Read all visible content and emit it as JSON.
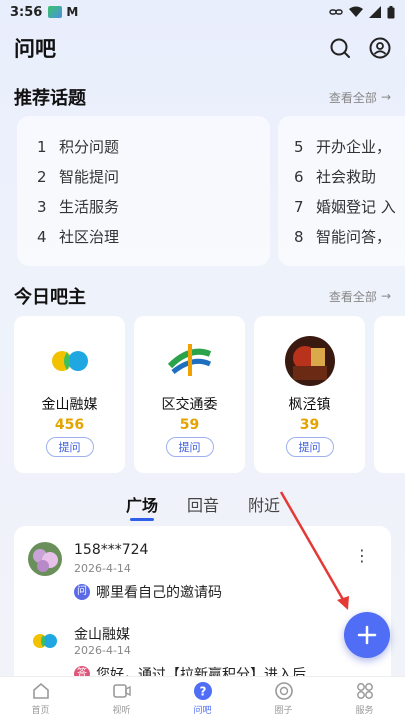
{
  "status": {
    "time": "3:56"
  },
  "header": {
    "title": "问吧"
  },
  "recommended": {
    "title": "推荐话题",
    "more": "查看全部",
    "topics": [
      {
        "num": "1",
        "label": "积分问题"
      },
      {
        "num": "2",
        "label": "智能提问"
      },
      {
        "num": "3",
        "label": "生活服务"
      },
      {
        "num": "4",
        "label": "社区治理"
      },
      {
        "num": "5",
        "label": "开办企业，"
      },
      {
        "num": "6",
        "label": "社会救助"
      },
      {
        "num": "7",
        "label": "婚姻登记 入"
      },
      {
        "num": "8",
        "label": "智能问答，"
      }
    ]
  },
  "hosts": {
    "title": "今日吧主",
    "more": "查看全部",
    "items": [
      {
        "name": "金山融媒",
        "score": "456",
        "ask": "提问"
      },
      {
        "name": "区交通委",
        "score": "59",
        "ask": "提问"
      },
      {
        "name": "枫泾镇",
        "score": "39",
        "ask": "提问"
      }
    ]
  },
  "tabs": [
    {
      "label": "广场"
    },
    {
      "label": "回音"
    },
    {
      "label": "附近"
    }
  ],
  "feed": [
    {
      "user": "158***724",
      "date": "2026-4-14",
      "badge": "问",
      "question": "哪里看自己的邀请码"
    },
    {
      "user": "金山融媒",
      "date": "2026-4-14",
      "badge": "答",
      "question": "您好，通过【拉新赢积分】进入后"
    }
  ],
  "nav": [
    {
      "label": "首页",
      "icon": "home-icon"
    },
    {
      "label": "视听",
      "icon": "video-icon"
    },
    {
      "label": "问吧",
      "icon": "question-icon"
    },
    {
      "label": "圈子",
      "icon": "circle-icon"
    },
    {
      "label": "服务",
      "icon": "grid-icon"
    }
  ],
  "colors": {
    "accent": "#4f6df5",
    "score": "#e4a300",
    "arrow": "#e53935"
  }
}
